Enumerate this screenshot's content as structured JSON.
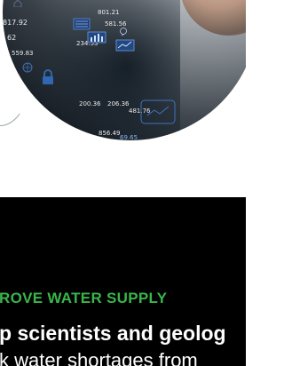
{
  "hero": {
    "overlay_numbers": [
      "817.92",
      "62",
      "559.83",
      "234.53",
      "801.21",
      "581.56",
      "200.36",
      "206.36",
      "481.76",
      "856.49",
      "69.65"
    ],
    "icons": [
      "lock-icon",
      "globe-icon",
      "chat-bubble-icon",
      "database-icon",
      "bar-chart-icon"
    ]
  },
  "section": {
    "eyebrow": "ROVE WATER SUPPLY",
    "headline": "p scientists and geolog",
    "subtext": "k water shortages from"
  },
  "colors": {
    "accent": "#39b54a",
    "dark_bg": "#000000",
    "text": "#ffffff"
  }
}
